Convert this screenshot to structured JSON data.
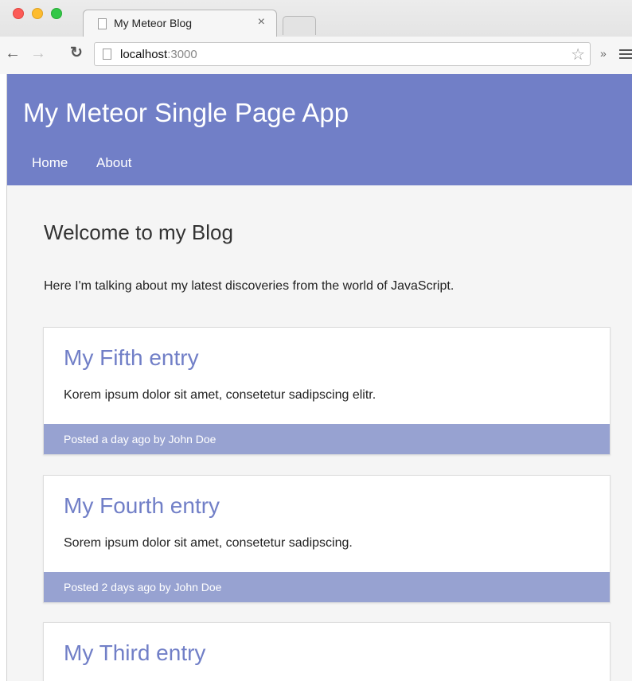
{
  "browser": {
    "tab_title": "My Meteor Blog",
    "tab_close": "×",
    "url_host": "localhost",
    "url_port": ":3000",
    "icons": {
      "back": "left-arrow-icon",
      "forward": "right-arrow-icon",
      "reload": "reload-icon",
      "bookmark": "star-icon",
      "overflow": "double-chevron-icon",
      "menu": "hamburger-menu-icon"
    }
  },
  "site": {
    "title": "My Meteor Single Page App",
    "nav": [
      "Home",
      "About"
    ]
  },
  "main": {
    "heading": "Welcome to my Blog",
    "intro": "Here I'm talking about my latest discoveries from the world of JavaScript.",
    "posts": [
      {
        "title": "My Fifth entry",
        "body": "Korem ipsum dolor sit amet, consetetur sadipscing elitr.",
        "meta": "Posted a day ago by John Doe"
      },
      {
        "title": "My Fourth entry",
        "body": "Sorem ipsum dolor sit amet, consetetur sadipscing.",
        "meta": "Posted 2 days ago by John Doe"
      },
      {
        "title": "My Third entry"
      }
    ]
  },
  "colors": {
    "accent": "#717fc7",
    "footer": "#97a2d1",
    "page_bg": "#f5f5f5"
  }
}
